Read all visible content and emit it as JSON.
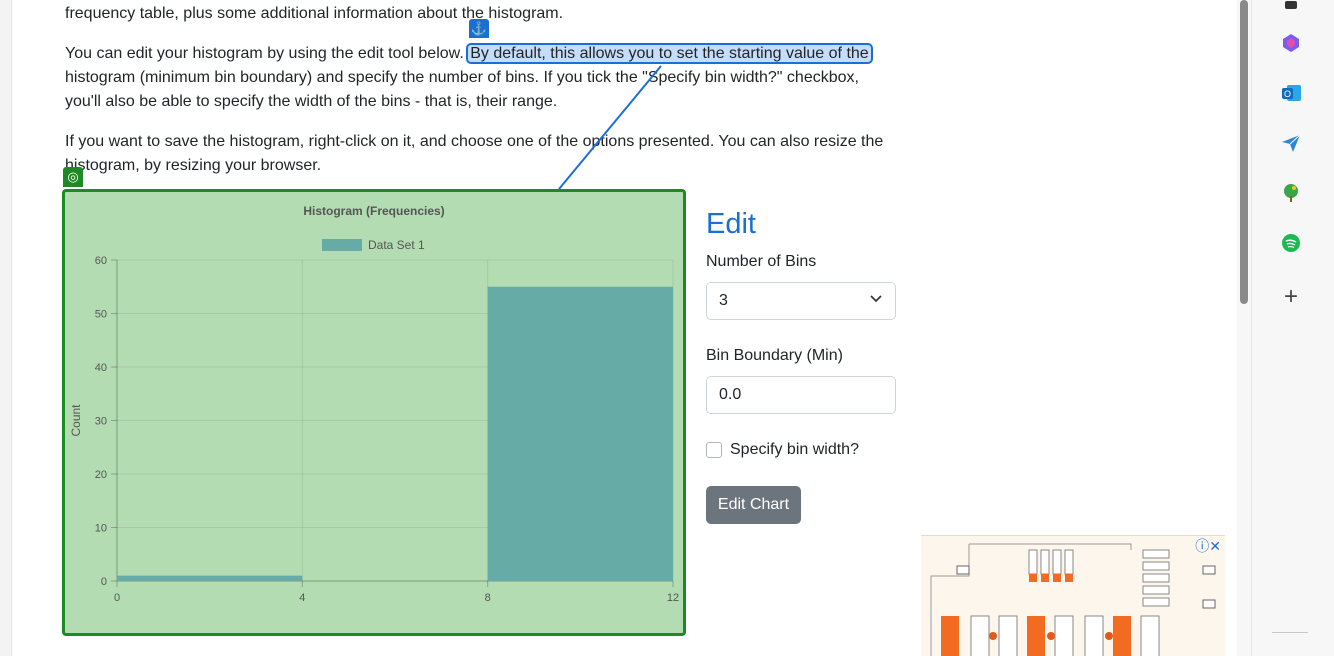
{
  "article": {
    "para0": "frequency table, plus some additional information about the histogram.",
    "para1_before": "You can edit your histogram by using the edit tool below.",
    "para1_highlight": "By default, this allows you to set the starting value of the",
    "para1_after": "histogram (minimum bin boundary) and specify the number of bins. If you tick the \"Specify bin width?\" checkbox, you'll also be able to specify the width of the bins - that is, their range.",
    "para2": "If you want to save the histogram, right-click on it, and choose one of the options presented. You can also resize the histogram, by resizing your browser."
  },
  "annotation": {
    "anchor_icon": "anchor-icon",
    "target_icon": "target-icon",
    "anchor_color": "#1a6fd6",
    "target_color": "#1e8a23"
  },
  "chart_data": {
    "type": "bar",
    "title": "Histogram (Frequencies)",
    "legend": [
      "Data Set 1"
    ],
    "legend_position": "top",
    "ylabel": "Count",
    "xlabel": "",
    "x_ticks": [
      "0",
      "4",
      "8",
      "12"
    ],
    "y_ticks": [
      "0",
      "10",
      "20",
      "30",
      "40",
      "50",
      "60"
    ],
    "xlim": [
      0,
      12
    ],
    "ylim": [
      0,
      60
    ],
    "grid": true,
    "bar_color": "#66aba5",
    "bins": [
      {
        "from": 0,
        "to": 4,
        "value": 1
      },
      {
        "from": 4,
        "to": 8,
        "value": 0
      },
      {
        "from": 8,
        "to": 12,
        "value": 55
      }
    ]
  },
  "edit": {
    "title": "Edit",
    "bins_label": "Number of Bins",
    "bins_value": "3",
    "min_label": "Bin Boundary (Min)",
    "min_value": "0.0",
    "checkbox_label": "Specify bin width?",
    "button_label": "Edit Chart"
  },
  "ad": {
    "info_icon": "info-icon",
    "close_icon": "close-icon"
  },
  "sidebar": {
    "icons": [
      "profile-icon",
      "copilot-icon",
      "outlook-icon",
      "send-icon",
      "tree-icon",
      "spotify-icon",
      "add-icon"
    ]
  }
}
